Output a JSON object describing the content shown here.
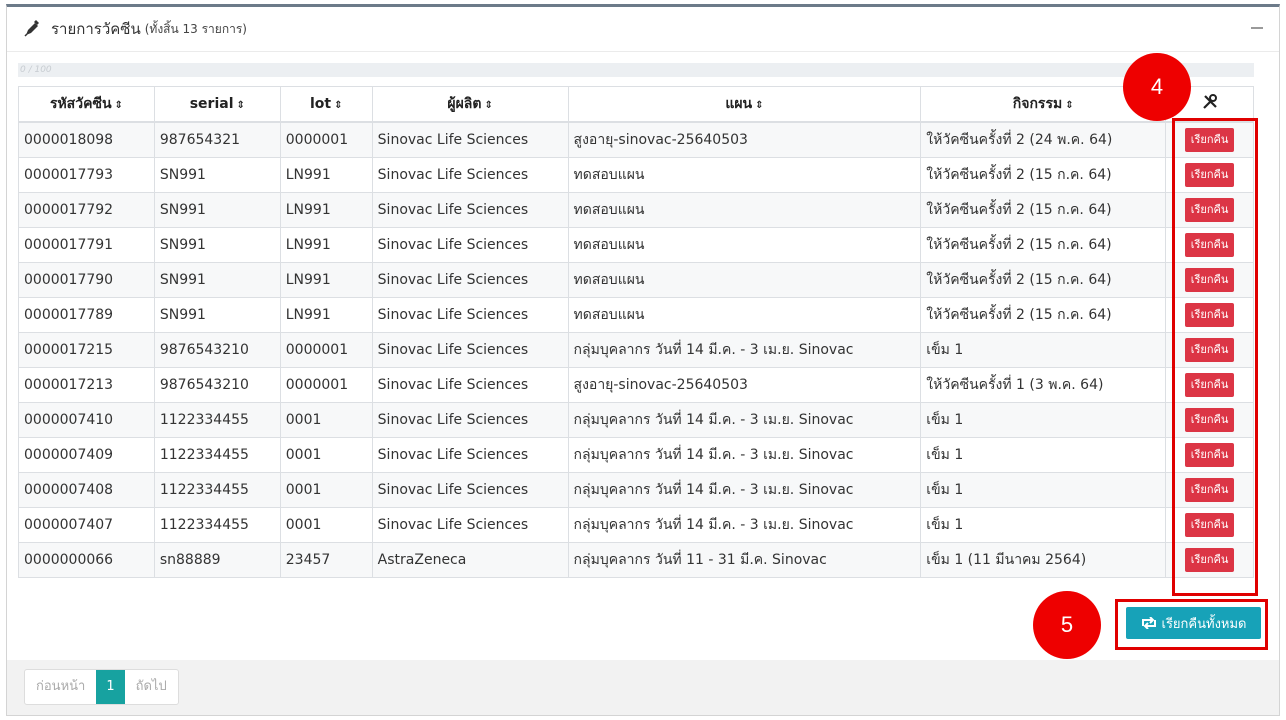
{
  "panel": {
    "title": "รายการวัคซีน",
    "subtitle": "(ทั้งสิ้น 13 รายการ)",
    "progress_text": "0 / 100"
  },
  "table": {
    "headers": {
      "code": "รหัสวัคซีน",
      "serial": "serial",
      "lot": "lot",
      "manufacturer": "ผู้ผลิต",
      "plan": "แผน",
      "activity": "กิจกรรม",
      "sort_glyph": "⇕"
    },
    "action_label": "เรียกคืน",
    "rows": [
      {
        "code": "0000018098",
        "serial": "987654321",
        "lot": "0000001",
        "manufacturer": "Sinovac Life Sciences",
        "plan": "สูงอายุ-sinovac-25640503",
        "activity": "ให้วัคซีนครั้งที่ 2 (24 พ.ค. 64)"
      },
      {
        "code": "0000017793",
        "serial": "SN991",
        "lot": "LN991",
        "manufacturer": "Sinovac Life Sciences",
        "plan": "ทดสอบแผน",
        "activity": "ให้วัคซีนครั้งที่ 2 (15 ก.ค. 64)"
      },
      {
        "code": "0000017792",
        "serial": "SN991",
        "lot": "LN991",
        "manufacturer": "Sinovac Life Sciences",
        "plan": "ทดสอบแผน",
        "activity": "ให้วัคซีนครั้งที่ 2 (15 ก.ค. 64)"
      },
      {
        "code": "0000017791",
        "serial": "SN991",
        "lot": "LN991",
        "manufacturer": "Sinovac Life Sciences",
        "plan": "ทดสอบแผน",
        "activity": "ให้วัคซีนครั้งที่ 2 (15 ก.ค. 64)"
      },
      {
        "code": "0000017790",
        "serial": "SN991",
        "lot": "LN991",
        "manufacturer": "Sinovac Life Sciences",
        "plan": "ทดสอบแผน",
        "activity": "ให้วัคซีนครั้งที่ 2 (15 ก.ค. 64)"
      },
      {
        "code": "0000017789",
        "serial": "SN991",
        "lot": "LN991",
        "manufacturer": "Sinovac Life Sciences",
        "plan": "ทดสอบแผน",
        "activity": "ให้วัคซีนครั้งที่ 2 (15 ก.ค. 64)"
      },
      {
        "code": "0000017215",
        "serial": "9876543210",
        "lot": "0000001",
        "manufacturer": "Sinovac Life Sciences",
        "plan": "กลุ่มบุคลากร วันที่ 14 มี.ค. - 3 เม.ย. Sinovac",
        "activity": "เข็ม 1"
      },
      {
        "code": "0000017213",
        "serial": "9876543210",
        "lot": "0000001",
        "manufacturer": "Sinovac Life Sciences",
        "plan": "สูงอายุ-sinovac-25640503",
        "activity": "ให้วัคซีนครั้งที่ 1 (3 พ.ค. 64)"
      },
      {
        "code": "0000007410",
        "serial": "1122334455",
        "lot": "0001",
        "manufacturer": "Sinovac Life Sciences",
        "plan": "กลุ่มบุคลากร วันที่ 14 มี.ค. - 3 เม.ย. Sinovac",
        "activity": "เข็ม 1"
      },
      {
        "code": "0000007409",
        "serial": "1122334455",
        "lot": "0001",
        "manufacturer": "Sinovac Life Sciences",
        "plan": "กลุ่มบุคลากร วันที่ 14 มี.ค. - 3 เม.ย. Sinovac",
        "activity": "เข็ม 1"
      },
      {
        "code": "0000007408",
        "serial": "1122334455",
        "lot": "0001",
        "manufacturer": "Sinovac Life Sciences",
        "plan": "กลุ่มบุคลากร วันที่ 14 มี.ค. - 3 เม.ย. Sinovac",
        "activity": "เข็ม 1"
      },
      {
        "code": "0000007407",
        "serial": "1122334455",
        "lot": "0001",
        "manufacturer": "Sinovac Life Sciences",
        "plan": "กลุ่มบุคลากร วันที่ 14 มี.ค. - 3 เม.ย. Sinovac",
        "activity": "เข็ม 1"
      },
      {
        "code": "0000000066",
        "serial": "sn88889",
        "lot": "23457",
        "manufacturer": "AstraZeneca",
        "plan": "กลุ่มบุคลากร วันที่ 11 - 31 มี.ค. Sinovac",
        "activity": "เข็ม 1 (11 มีนาคม 2564)"
      }
    ]
  },
  "recall_all_label": "เรียกคืนทั้งหมด",
  "pagination": {
    "prev": "ก่อนหน้า",
    "current": "1",
    "next": "ถัดไป"
  },
  "annotations": {
    "callout_4": "4",
    "callout_5": "5"
  },
  "icons": {
    "header": "pencil-icon",
    "actions_column": "tools-icon",
    "recall_all": "retweet-icon"
  },
  "colors": {
    "danger": "#dc3545",
    "info": "#17a2b8",
    "callout": "#ee0000",
    "page_active": "#17a2a0"
  }
}
